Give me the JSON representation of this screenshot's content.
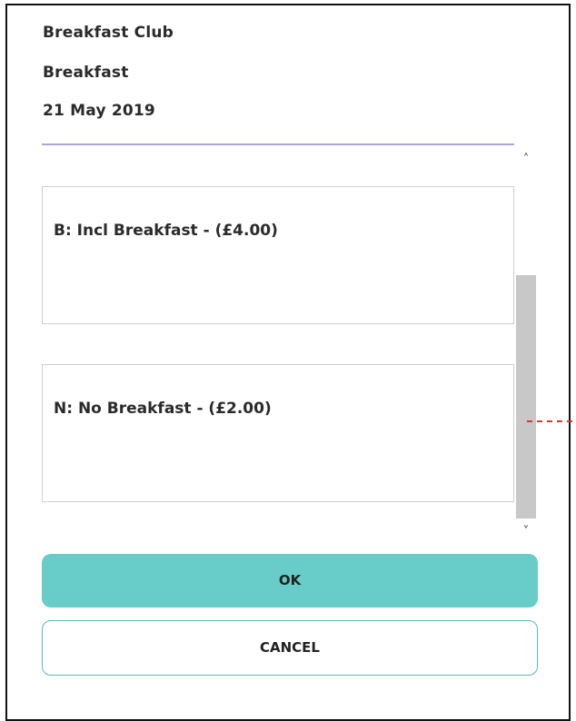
{
  "header": {
    "club_name": "Breakfast Club",
    "session_name": "Breakfast",
    "date": "21 May 2019"
  },
  "options": [
    {
      "label": "B: Incl Breakfast - (£4.00)"
    },
    {
      "label": "N: No Breakfast - (£2.00)"
    }
  ],
  "scrollbar": {
    "up_glyph": "˄",
    "down_glyph": "˅"
  },
  "buttons": {
    "ok_label": "OK",
    "cancel_label": "CANCEL"
  },
  "colors": {
    "accent": "#68cdc9",
    "accent_border": "#5fb8b5",
    "divider": "#a8a6de",
    "annotation": "#e0322e"
  }
}
